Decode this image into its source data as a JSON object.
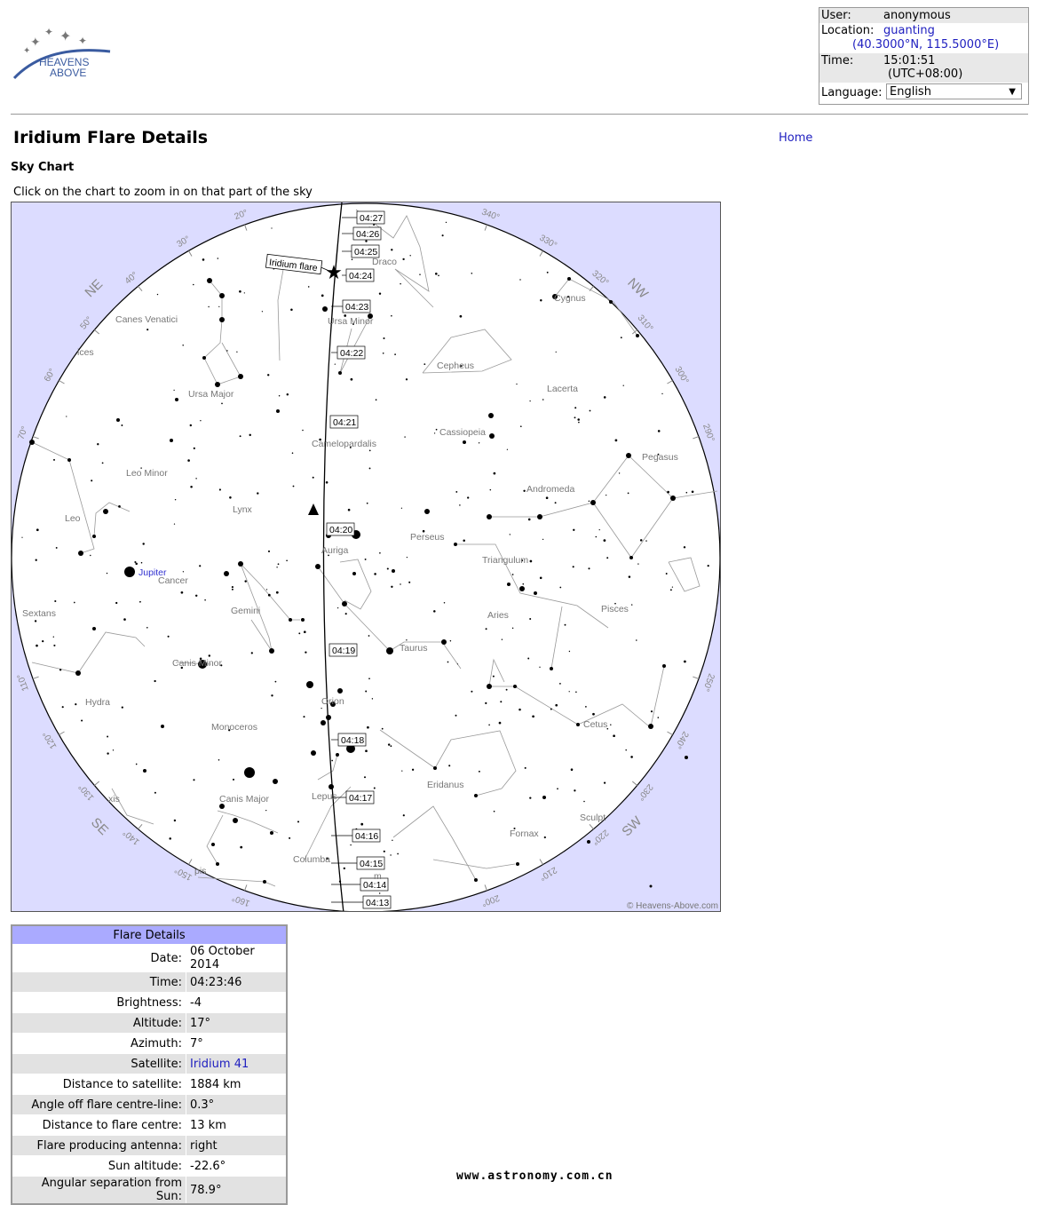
{
  "logo": {
    "line1": "HEAVENS",
    "line2": "ABOVE"
  },
  "user_box": {
    "user_label": "User:",
    "user_value": "anonymous",
    "location_label": "Location:",
    "location_value": "guanting",
    "coords": "(40.3000°N, 115.5000°E)",
    "time_label": "Time:",
    "time_value": "15:01:51",
    "tz": "(UTC+08:00)",
    "language_label": "Language:",
    "language_value": "English"
  },
  "page": {
    "title": "Iridium Flare Details",
    "home_link": "Home",
    "section": "Sky Chart",
    "hint": "Click on the chart to zoom in on that part of the sky"
  },
  "chart": {
    "copyright": "© Heavens-Above.com",
    "flare_label": "Iridium flare",
    "directions": [
      "NE",
      "NW",
      "SE",
      "SW"
    ],
    "azimuth_ticks": [
      "20°",
      "30°",
      "40°",
      "50°",
      "60°",
      "70°",
      "110°",
      "120°",
      "130°",
      "140°",
      "150°",
      "160°",
      "200°",
      "210°",
      "220°",
      "230°",
      "240°",
      "250°",
      "290°",
      "300°",
      "310°",
      "320°",
      "330°",
      "340°"
    ],
    "time_labels": [
      "04:27",
      "04:26",
      "04:25",
      "04:24",
      "04:23",
      "04:22",
      "04:21",
      "04:20",
      "04:19",
      "04:18",
      "04:17",
      "04:16",
      "04:15",
      "04:14",
      "04:13"
    ],
    "constellations": [
      "Draco",
      "Ursa Minor",
      "Cygnus",
      "Canes Venatici",
      "Cepheus",
      "Ursa Major",
      "Lacerta",
      "Cassiopeia",
      "Camelopardalis",
      "Pegasus",
      "Leo Minor",
      "Andromeda",
      "Lynx",
      "Leo",
      "Perseus",
      "Triangulum",
      "Auriga",
      "Jupiter",
      "Cancer",
      "Sextans",
      "Gemini",
      "Aries",
      "Pisces",
      "Taurus",
      "Canis Minor",
      "Orion",
      "Hydra",
      "Cetus",
      "Monoceros",
      "Eridanus",
      "Canis Major",
      "Lepus",
      "Sculpt",
      "Fornax",
      "Columba",
      "pis",
      "xis",
      "ices",
      "m"
    ]
  },
  "flare_details": {
    "header": "Flare Details",
    "rows": [
      {
        "k": "Date:",
        "v": "06 October 2014"
      },
      {
        "k": "Time:",
        "v": "04:23:46"
      },
      {
        "k": "Brightness:",
        "v": "-4"
      },
      {
        "k": "Altitude:",
        "v": "17°"
      },
      {
        "k": "Azimuth:",
        "v": "7°"
      },
      {
        "k": "Satellite:",
        "v": "Iridium 41"
      },
      {
        "k": "Distance to satellite:",
        "v": "1884 km"
      },
      {
        "k": "Angle off flare centre-line:",
        "v": "0.3°"
      },
      {
        "k": "Distance to flare centre:",
        "v": "13 km"
      },
      {
        "k": "Flare producing antenna:",
        "v": "right"
      },
      {
        "k": "Sun altitude:",
        "v": "-22.6°"
      },
      {
        "k": "Angular separation from Sun:",
        "v": "78.9°"
      }
    ]
  },
  "watermark": "www.astronomy.com.cn"
}
